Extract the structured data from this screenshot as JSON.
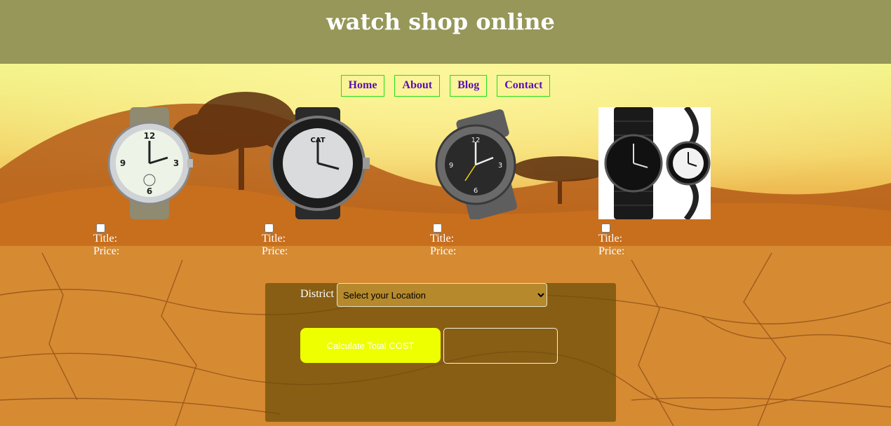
{
  "header": {
    "title": "watch shop online"
  },
  "nav": {
    "items": [
      "Home",
      "About",
      "Blog",
      "Contact"
    ]
  },
  "products": [
    {
      "title_label": "Title:",
      "price_label": "Price:",
      "image": "citizen-field-watch"
    },
    {
      "title_label": "Title:",
      "price_label": "Price:",
      "image": "cat-sport-watch"
    },
    {
      "title_label": "Title:",
      "price_label": "Price:",
      "image": "grey-pilot-watch"
    },
    {
      "title_label": "Title:",
      "price_label": "Price:",
      "image": "black-couple-watches"
    }
  ],
  "order": {
    "district_label": "District",
    "district_selected": "Select your Location",
    "calculate_label": "Calculate Total COST",
    "total_value": ""
  },
  "colors": {
    "header_bg": "#969758",
    "nav_text": "#5a0fb5",
    "nav_border": "#1fe01f",
    "button_bg": "#eeff00"
  }
}
